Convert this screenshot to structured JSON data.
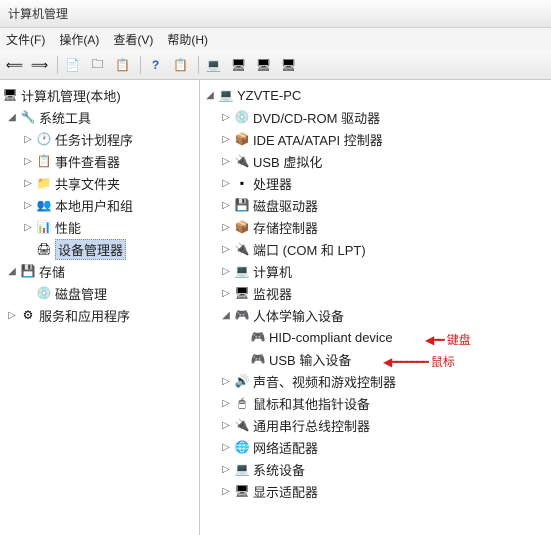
{
  "window": {
    "title": "计算机管理"
  },
  "menu": {
    "file": "文件(F)",
    "action": "操作(A)",
    "view": "查看(V)",
    "help": "帮助(H)"
  },
  "toolbar_icons": {
    "back": "back-icon",
    "forward": "forward-icon",
    "up": "up-icon",
    "show_hide": "show-hide-icon",
    "properties": "properties-icon",
    "help": "help-icon",
    "refresh": "refresh-icon",
    "scan": "scan-icon",
    "update": "update-icon",
    "uninstall": "uninstall-icon",
    "disable": "disable-icon"
  },
  "left_tree": {
    "root": "计算机管理(本地)",
    "system_tools": "系统工具",
    "task_scheduler": "任务计划程序",
    "event_viewer": "事件查看器",
    "shared_folders": "共享文件夹",
    "local_users": "本地用户和组",
    "performance": "性能",
    "device_manager": "设备管理器",
    "storage": "存储",
    "disk_mgmt": "磁盘管理",
    "services": "服务和应用程序"
  },
  "right_tree": {
    "computer": "YZVTE-PC",
    "dvd": "DVD/CD-ROM 驱动器",
    "ide": "IDE ATA/ATAPI 控制器",
    "usb_virt": "USB 虚拟化",
    "processor": "处理器",
    "disk_drive": "磁盘驱动器",
    "storage_ctrl": "存储控制器",
    "ports": "端口 (COM 和 LPT)",
    "computers": "计算机",
    "monitor": "监视器",
    "hid": "人体学输入设备",
    "hid_device": "HID-compliant device",
    "usb_input": "USB 输入设备",
    "sound": "声音、视频和游戏控制器",
    "mouse": "鼠标和其他指针设备",
    "usb_ctrl": "通用串行总线控制器",
    "network": "网络适配器",
    "system_dev": "系统设备",
    "display": "显示适配器"
  },
  "annotations": {
    "keyboard": "键盘",
    "mouse": "鼠标"
  }
}
